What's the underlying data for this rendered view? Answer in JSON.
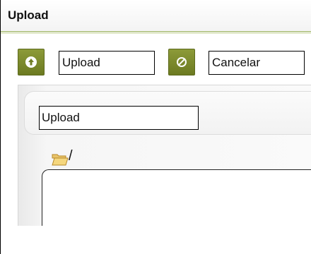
{
  "window": {
    "title": "Upload"
  },
  "toolbar": {
    "upload_icon": "arrow-up-circle-icon",
    "upload_label": "Upload",
    "cancel_icon": "cancel-circle-icon",
    "cancel_label": "Cancelar"
  },
  "panel": {
    "upload_label": "Upload",
    "folder_icon": "folder-open-icon",
    "current_path": "/"
  },
  "colors": {
    "accent_olive": "#7a8a2b",
    "title_rule": "#b9c98e"
  }
}
